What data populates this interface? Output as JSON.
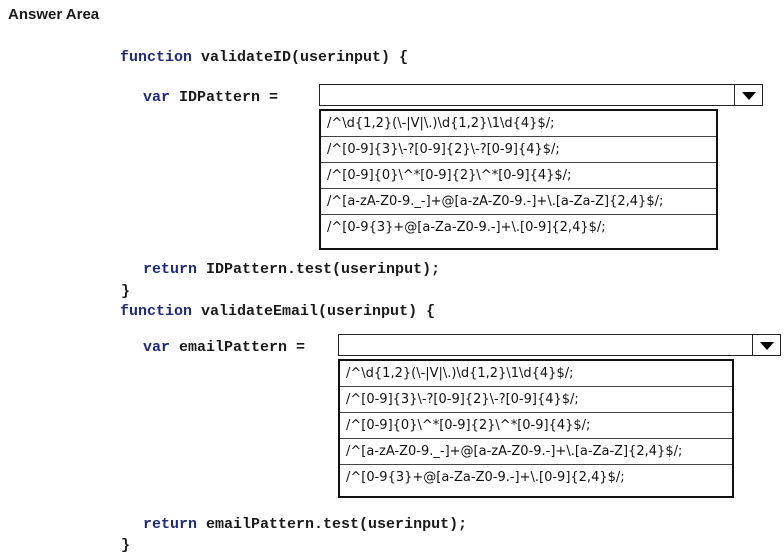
{
  "answer_area": {
    "heading": "Answer Area"
  },
  "code": {
    "func1_keyword": "function",
    "func1_signature": "validateID(userinput) {",
    "var1_keyword": "var",
    "var1_assign": "IDPattern =",
    "return1_keyword": "return",
    "return1_expr": "IDPattern.test(userinput);",
    "close1": "}",
    "func2_keyword": "function",
    "func2_signature": "validateEmail(userinput) {",
    "var2_keyword": "var",
    "var2_assign": "emailPattern =",
    "return2_keyword": "return",
    "return2_expr": "emailPattern.test(userinput);",
    "close2": "}"
  },
  "dropdown_icon": "triangle-down-icon",
  "id_pattern_select": {
    "selected_value": "",
    "options": [
      "/^\\d{1,2}(\\-|V|\\.)\\d{1,2}\\1\\d{4}$/;",
      "/^[0-9]{3}\\-?[0-9]{2}\\-?[0-9]{4}$/;",
      "/^[0-9]{0}\\^*[0-9]{2}\\^*[0-9]{4}$/;",
      "/^[a-zA-Z0-9._-]+@[a-zA-Z0-9.-]+\\.[a-Za-Z]{2,4}$/;",
      "/^[0-9{3}+@[a-Za-Z0-9.-]+\\.[0-9]{2,4}$/;"
    ]
  },
  "email_pattern_select": {
    "selected_value": "",
    "options": [
      "/^\\d{1,2}(\\-|V|\\.)\\d{1,2}\\1\\d{4}$/;",
      "/^[0-9]{3}\\-?[0-9]{2}\\-?[0-9]{4}$/;",
      "/^[0-9]{0}\\^*[0-9]{2}\\^*[0-9]{4}$/;",
      "/^[a-zA-Z0-9._-]+@[a-zA-Z0-9.-]+\\.[a-Za-Z]{2,4}$/;",
      "/^[0-9{3}+@[a-Za-Z0-9.-]+\\.[0-9]{2,4}$/;"
    ]
  }
}
